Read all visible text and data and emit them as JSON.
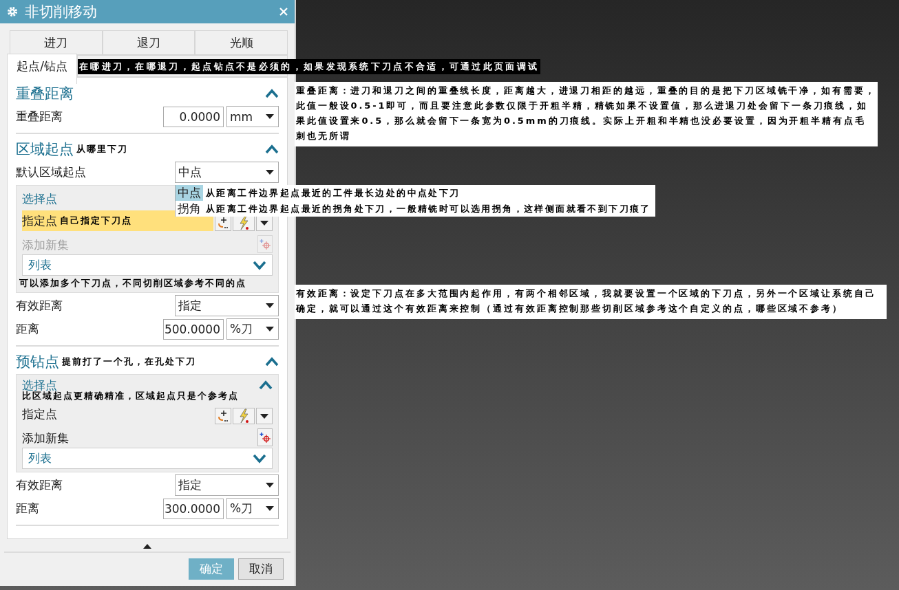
{
  "window": {
    "title": "非切削移动"
  },
  "tab_rows": [
    {
      "tabs": [
        {
          "label": "进刀",
          "selected": false
        },
        {
          "label": "退刀",
          "selected": false
        },
        {
          "label": "光顺",
          "selected": false
        }
      ]
    },
    {
      "tabs": [
        {
          "label": "起点/钻点",
          "selected": true
        }
      ]
    }
  ],
  "sections": [
    {
      "title": "重叠距离",
      "expanded": true,
      "rows": [
        {
          "kind": "value",
          "label": "重叠距离",
          "value": "0.0000",
          "unit": "mm"
        }
      ]
    },
    {
      "title": "区域起点",
      "note": "从哪里下刀",
      "expanded": true,
      "rows": [
        {
          "kind": "select",
          "label": "默认区域起点",
          "value": "中点"
        },
        {
          "kind": "group",
          "title": "选择点",
          "point": {
            "label": "指定点",
            "highlighted": true,
            "note": "自己指定下刀点"
          },
          "add": {
            "label": "添加新集",
            "disabled": true
          },
          "list": {
            "label": "列表"
          },
          "footer_note": "可以添加多个下刀点，不同切削区域参考不同的点"
        },
        {
          "kind": "select",
          "label": "有效距离",
          "value": "指定"
        },
        {
          "kind": "value",
          "label": "距离",
          "value": "500.0000",
          "unit": "%刀"
        }
      ]
    },
    {
      "title": "预钻点",
      "note": "提前打了一个孔，在孔处下刀",
      "expanded": true,
      "rows": [
        {
          "kind": "group",
          "title": "选择点",
          "expanded": true,
          "title_note": "比区域起点更精确精准，区域起点只是个参考点",
          "point": {
            "label": "指定点",
            "highlighted": false
          },
          "add": {
            "label": "添加新集",
            "disabled": false
          },
          "list": {
            "label": "列表"
          }
        },
        {
          "kind": "select",
          "label": "有效距离",
          "value": "指定"
        },
        {
          "kind": "value",
          "label": "距离",
          "value": "300.0000",
          "unit": "%刀"
        }
      ]
    }
  ],
  "dropdown_menu": {
    "options": [
      {
        "label": "中点",
        "selected": true,
        "note": "从距离工件边界起点最近的工件最长边处的中点处下刀"
      },
      {
        "label": "拐角",
        "selected": false,
        "note": "从距离工件边界起点最近的拐角处下刀，一般精铣时可以选用拐角，这样侧面就看不到下刀痕了"
      }
    ]
  },
  "annotations": [
    {
      "kind": "dark",
      "text": "在哪进刀，在哪退刀，起点钻点不是必须的，如果发现系统下刀点不合适，可通过此页面调试"
    },
    {
      "kind": "light",
      "text": "重叠距离：进刀和退刀之间的重叠线长度，距离越大，进退刀相距的越远，重叠的目的是把下刀区域铣干净，如有需要，此值一般设0.5-1即可，而且要注意此参数仅限于开粗半精，精铣如果不设置值，那么进退刀处会留下一条刀痕线，如果此值设置来0.5，那么就会留下一条宽为0.5mm的刀痕线。实际上开粗和半精也没必要设置，因为开粗半精有点毛刺也无所谓"
    },
    {
      "kind": "light",
      "text": "有效距离：设定下刀点在多大范围内起作用，有两个相邻区域，我就要设置一个区域的下刀点，另外一个区域让系统自己确定，就可以通过这个有效距离来控制（通过有效距离控制那些切削区域参考这个自定义的点，哪些区域不参考）"
    }
  ],
  "buttons": [
    {
      "label": "确定",
      "kind": "primary"
    },
    {
      "label": "取消",
      "kind": "secondary"
    }
  ]
}
